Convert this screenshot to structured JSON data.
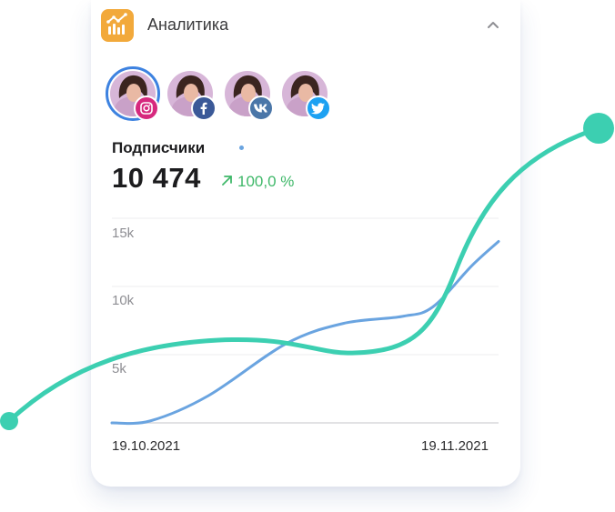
{
  "header": {
    "title": "Аналитика",
    "icon": "analytics-icon",
    "icon_color": "#f2a93b",
    "collapse_icon": "chevron-up-icon"
  },
  "profiles": [
    {
      "network": "instagram",
      "icon": "instagram-icon",
      "color": "#d6297e",
      "selected": true
    },
    {
      "network": "facebook",
      "icon": "facebook-icon",
      "color": "#3b5998",
      "selected": false
    },
    {
      "network": "vk",
      "icon": "vk-icon",
      "color": "#4a76a8",
      "selected": false
    },
    {
      "network": "twitter",
      "icon": "twitter-icon",
      "color": "#1da1f2",
      "selected": false
    }
  ],
  "metric": {
    "label": "Подписчики",
    "value": "10 474",
    "change": "100,0 %",
    "change_color": "#3fb869"
  },
  "chart_data": {
    "type": "line",
    "x": [
      "19.10.2021",
      "19.11.2021"
    ],
    "y_ticks": [
      "5k",
      "10k",
      "15k"
    ],
    "ylim": [
      0,
      15000
    ],
    "grid": true,
    "series": [
      {
        "color": "#6aa4e0",
        "points": [
          {
            "t": 0.0,
            "y": 0
          },
          {
            "t": 0.1,
            "y": 150
          },
          {
            "t": 0.25,
            "y": 2000
          },
          {
            "t": 0.45,
            "y": 5800
          },
          {
            "t": 0.6,
            "y": 7300
          },
          {
            "t": 0.75,
            "y": 7800
          },
          {
            "t": 0.83,
            "y": 8500
          },
          {
            "t": 0.93,
            "y": 11500
          },
          {
            "t": 1.0,
            "y": 13300
          }
        ]
      }
    ]
  }
}
